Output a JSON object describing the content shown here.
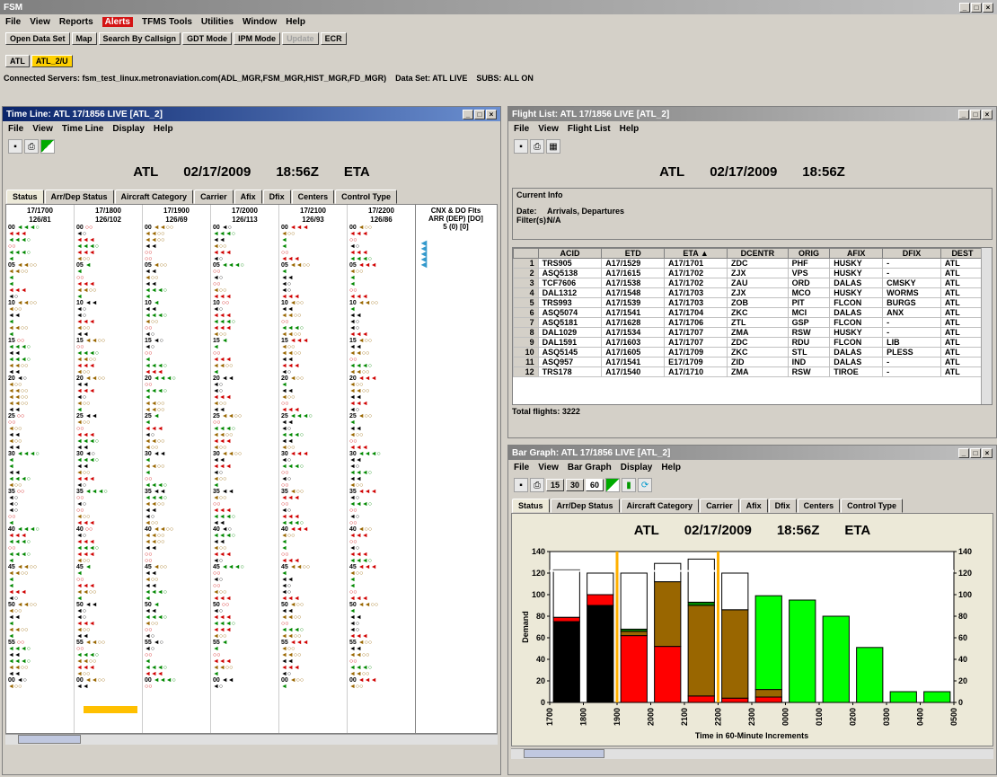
{
  "app": {
    "title": "FSM",
    "menus": [
      "File",
      "View",
      "Reports",
      "Alerts",
      "TFMS Tools",
      "Utilities",
      "Window",
      "Help"
    ],
    "toolbar": [
      "Open Data Set",
      "Map",
      "Search By Callsign",
      "GDT Mode",
      "IPM Mode",
      "Update",
      "ECR"
    ],
    "dataset_tabs": [
      "ATL",
      "ATL_2/U"
    ],
    "status_line": "Connected Servers: fsm_test_linux.metronaviation.com(ADL_MGR,FSM_MGR,HIST_MGR,FD_MGR)    Data Set: ATL LIVE    SUBS: ALL ON"
  },
  "timeline": {
    "title": "Time Line: ATL 17/1856 LIVE [ATL_2]",
    "menus": [
      "File",
      "View",
      "Time Line",
      "Display",
      "Help"
    ],
    "header": [
      "ATL",
      "02/17/2009",
      "18:56Z",
      "ETA"
    ],
    "tabs": [
      "Status",
      "Arr/Dep Status",
      "Aircraft Category",
      "Carrier",
      "Afix",
      "Dfix",
      "Centers",
      "Control Type"
    ],
    "columns": [
      {
        "t": "17/1700",
        "c": "126/81"
      },
      {
        "t": "17/1800",
        "c": "126/102"
      },
      {
        "t": "17/1900",
        "c": "126/69"
      },
      {
        "t": "17/2000",
        "c": "126/113"
      },
      {
        "t": "17/2100",
        "c": "126/93"
      },
      {
        "t": "17/2200",
        "c": "126/86"
      }
    ],
    "cnx_title": "CNX & DO Flts",
    "cnx_sub": "ARR (DEP) [DO]",
    "cnx_val": "5 (0) [0]",
    "minute_marks": [
      "00",
      "05",
      "10",
      "15",
      "20",
      "25",
      "30",
      "35",
      "40",
      "45",
      "50",
      "55"
    ]
  },
  "flightlist": {
    "title": "Flight List: ATL 17/1856 LIVE [ATL_2]",
    "menus": [
      "File",
      "View",
      "Flight List",
      "Help"
    ],
    "header": [
      "ATL",
      "02/17/2009",
      "18:56Z"
    ],
    "info_title": "Current Info",
    "date_label": "Date:",
    "date_value": "Arrivals, Departures",
    "filter_label": "Filter(s):",
    "filter_value": "N/A",
    "columns": [
      "",
      "ACID",
      "ETD",
      "ETA ▲",
      "DCENTR",
      "ORIG",
      "AFIX",
      "DFIX",
      "DEST"
    ],
    "rows": [
      [
        "1",
        "TRS905",
        "A17/1529",
        "A17/1701",
        "ZDC",
        "PHF",
        "HUSKY",
        "-",
        "ATL"
      ],
      [
        "2",
        "ASQ5138",
        "A17/1615",
        "A17/1702",
        "ZJX",
        "VPS",
        "HUSKY",
        "-",
        "ATL"
      ],
      [
        "3",
        "TCF7606",
        "A17/1538",
        "A17/1702",
        "ZAU",
        "ORD",
        "DALAS",
        "CMSKY",
        "ATL"
      ],
      [
        "4",
        "DAL1312",
        "A17/1548",
        "A17/1703",
        "ZJX",
        "MCO",
        "HUSKY",
        "WORMS",
        "ATL"
      ],
      [
        "5",
        "TRS993",
        "A17/1539",
        "A17/1703",
        "ZOB",
        "PIT",
        "FLCON",
        "BURGS",
        "ATL"
      ],
      [
        "6",
        "ASQ5074",
        "A17/1541",
        "A17/1704",
        "ZKC",
        "MCI",
        "DALAS",
        "ANX",
        "ATL"
      ],
      [
        "7",
        "ASQ5181",
        "A17/1628",
        "A17/1706",
        "ZTL",
        "GSP",
        "FLCON",
        "-",
        "ATL"
      ],
      [
        "8",
        "DAL1029",
        "A17/1534",
        "A17/1707",
        "ZMA",
        "RSW",
        "HUSKY",
        "-",
        "ATL"
      ],
      [
        "9",
        "DAL1591",
        "A17/1603",
        "A17/1707",
        "ZDC",
        "RDU",
        "FLCON",
        "LIB",
        "ATL"
      ],
      [
        "10",
        "ASQ5145",
        "A17/1605",
        "A17/1709",
        "ZKC",
        "STL",
        "DALAS",
        "PLESS",
        "ATL"
      ],
      [
        "11",
        "ASQ957",
        "A17/1541",
        "E17/1709",
        "ZID",
        "IND",
        "DALAS",
        "-",
        "ATL"
      ],
      [
        "12",
        "TRS178",
        "A17/1540",
        "A17/1710",
        "ZMA",
        "RSW",
        "TIROE",
        "-",
        "ATL"
      ]
    ],
    "total": "Total flights: 3222"
  },
  "bargraph": {
    "title": "Bar Graph: ATL 17/1856 LIVE [ATL_2]",
    "menus": [
      "File",
      "View",
      "Bar Graph",
      "Display",
      "Help"
    ],
    "intervals": [
      "15",
      "30",
      "60"
    ],
    "header": [
      "ATL",
      "02/17/2009",
      "18:56Z",
      "ETA"
    ],
    "tabs": [
      "Status",
      "Arr/Dep Status",
      "Aircraft Category",
      "Carrier",
      "Afix",
      "Dfix",
      "Centers",
      "Control Type"
    ]
  },
  "chart_data": {
    "type": "bar",
    "xlabel": "Time in 60-Minute Increments",
    "ylabel": "Demand",
    "ylim": [
      0,
      140
    ],
    "yticks": [
      0,
      20,
      40,
      60,
      80,
      100,
      120,
      140
    ],
    "categories": [
      "1700",
      "1800",
      "1900",
      "2000",
      "2100",
      "2200",
      "2300",
      "0000",
      "0100",
      "0200",
      "0300",
      "0400",
      "0500"
    ],
    "capacity": 122,
    "colors": {
      "black": "#000000",
      "red": "#ff0000",
      "brown": "#996600",
      "green": "#00ff00",
      "darkgreen": "#008800",
      "white": "#ffffff"
    },
    "stacks": [
      [
        {
          "c": "black",
          "v": 75
        },
        {
          "c": "red",
          "v": 4
        },
        {
          "c": "white",
          "v": 44
        }
      ],
      [
        {
          "c": "black",
          "v": 90
        },
        {
          "c": "red",
          "v": 10
        },
        {
          "c": "white",
          "v": 20
        }
      ],
      [
        {
          "c": "red",
          "v": 62
        },
        {
          "c": "brown",
          "v": 4
        },
        {
          "c": "darkgreen",
          "v": 2
        },
        {
          "c": "white",
          "v": 52
        }
      ],
      [
        {
          "c": "red",
          "v": 52
        },
        {
          "c": "brown",
          "v": 60
        },
        {
          "c": "white",
          "v": 17
        }
      ],
      [
        {
          "c": "red",
          "v": 6
        },
        {
          "c": "brown",
          "v": 84
        },
        {
          "c": "darkgreen",
          "v": 3
        },
        {
          "c": "white",
          "v": 40
        }
      ],
      [
        {
          "c": "red",
          "v": 4
        },
        {
          "c": "brown",
          "v": 82
        },
        {
          "c": "white",
          "v": 34
        }
      ],
      [
        {
          "c": "red",
          "v": 5
        },
        {
          "c": "brown",
          "v": 7
        },
        {
          "c": "green",
          "v": 87
        }
      ],
      [
        {
          "c": "green",
          "v": 95
        }
      ],
      [
        {
          "c": "green",
          "v": 80
        }
      ],
      [
        {
          "c": "green",
          "v": 51
        }
      ],
      [
        {
          "c": "green",
          "v": 10
        }
      ],
      [
        {
          "c": "green",
          "v": 10
        }
      ]
    ]
  }
}
